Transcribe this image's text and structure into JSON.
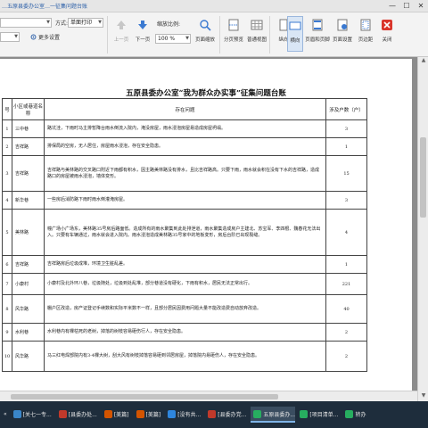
{
  "window": {
    "title": "…五原县委办公室…一征集问题台账"
  },
  "ribbon": {
    "printer_value": "",
    "method_label": "方式:",
    "method_value": "单面打印",
    "more_settings": "更多设置",
    "prev_page": "上一页",
    "next_page": "下一页",
    "zoom_label": "缩放比例:",
    "zoom_value": "100 %",
    "page_zoom": "页面缩放",
    "paged_preview": "分页预览",
    "normal_view": "普通视图",
    "portrait": "纵向",
    "landscape": "横向",
    "header_footer": "页眉和页脚",
    "page_setup": "页面设置",
    "page_margin": "页边距",
    "close": "关闭"
  },
  "document": {
    "title": "五原县委办公室“我为群众办实事”征集问题台账",
    "headers": {
      "no": "号",
      "area": "小区或巷道名称",
      "issue": "存在问题",
      "count": "涉及户数（户）"
    },
    "rows": [
      {
        "no": "1",
        "area": "三中巷",
        "issue": "路坑洼，下雨时马主排暂降台雨水倒流入院内，淹没房屋，雨水浸泡房屋易造成房屋坍塌。",
        "count": "3"
      },
      {
        "no": "2",
        "area": "吉祥路",
        "issue": "排保局的空房，无人居住，房屋雨水浸泡，存在安全隐患。",
        "count": "1"
      },
      {
        "no": "3",
        "area": "吉祥路",
        "issue": "吉祥路与美林路的交叉路口附近下雨都有积水，因主路美林路没有排水，且比吉祥路高。只要下雨，雨水就会积在没有下水的吉祥路，造成路口的房屋被雨水浸泡，墙体变形。",
        "count": "15"
      },
      {
        "no": "4",
        "area": "新华巷",
        "issue": "一些房后消防路下雨时雨水倒灌淹房屋。",
        "count": "3"
      },
      {
        "no": "5",
        "area": "美林路",
        "issue": "幢广场小广场东，美林路35号房后路面低。造成所有的雨水聚集到此处排泄道，雨水聚集造成房户主建北、苏宝军、李四根、魏春花无法出入。只要有车辆通过，雨水就会进入院内。雨水浸泡造成美林路35号家中的地板变形，房后台阶已出现裂缝。",
        "count": "4"
      },
      {
        "no": "6",
        "area": "吉祥路",
        "issue": "吉祥路房后垃圾成堆，环境卫生脏乱差。",
        "count": "1"
      },
      {
        "no": "7",
        "area": "小康村",
        "issue": "小康村及北外环八巷，垃圾随处，垃圾到处乱堆，部分巷道没有硬化，下雨有积水，居民无法正常出行。",
        "count": "221"
      },
      {
        "no": "8",
        "area": "风华路",
        "issue": "棚户区改造，房产证登记手续数和实际平米数不一样，且部分居民因费用问题大量不能改造费自动放弃改造。",
        "count": "40"
      },
      {
        "no": "9",
        "area": "水利巷",
        "issue": "水利巷内有棵枯死的老树，掉落的树枝容易砸伤行人，存在安全隐患。",
        "count": "2"
      },
      {
        "no": "10",
        "area": "风华路",
        "issue": "马三红电焊部院内有3-4棵大树，刮大风有树枝掉落容易砸到邻居房屋，掉落院内易砸伤人，存在安全隐患。",
        "count": "2"
      }
    ]
  },
  "taskbar": {
    "items": [
      {
        "label": "[关七一专...",
        "color": "#3a86c8",
        "active": false
      },
      {
        "label": "[县委办处...",
        "color": "#c0392b",
        "active": false
      },
      {
        "label": "[美篇]",
        "color": "#d35400",
        "active": false
      },
      {
        "label": "[美篇]",
        "color": "#d35400",
        "active": false
      },
      {
        "label": "[没有共...",
        "color": "#2e86de",
        "active": false
      },
      {
        "label": "[县委办党...",
        "color": "#c0392b",
        "active": false
      },
      {
        "label": "五原县委办...",
        "color": "#27ae60",
        "active": true
      },
      {
        "label": "[项目清单...",
        "color": "#27ae60",
        "active": false
      },
      {
        "label": "转办",
        "color": "#27ae60",
        "active": false
      }
    ]
  }
}
